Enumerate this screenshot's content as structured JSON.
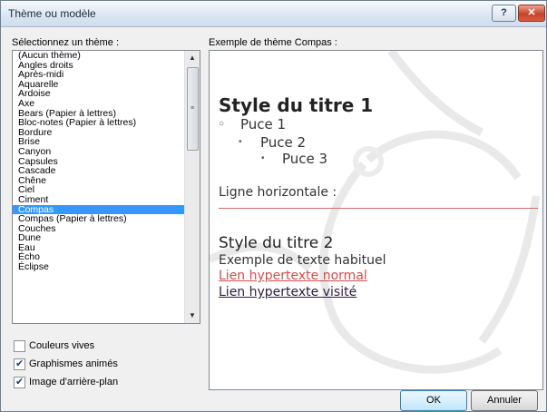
{
  "window": {
    "title": "Thème ou modèle",
    "help_label": "?",
    "close_label": "✕"
  },
  "theme_list": {
    "label": "Sélectionnez un thème :",
    "selected": "Compas",
    "items": [
      "(Aucun thème)",
      "Angles droits",
      "Après-midi",
      "Aquarelle",
      "Ardoise",
      "Axe",
      "Bears (Papier à lettres)",
      "Bloc-notes (Papier à lettres)",
      "Bordure",
      "Brise",
      "Canyon",
      "Capsules",
      "Cascade",
      "Chêne",
      "Ciel",
      "Ciment",
      "Compas",
      "Compas (Papier à lettres)",
      "Couches",
      "Dune",
      "Eau",
      "Écho",
      "Éclipse"
    ]
  },
  "preview": {
    "label": "Exemple de thème Compas :",
    "heading1": "Style du titre 1",
    "bullet1": "Puce 1",
    "bullet2": "Puce 2",
    "bullet3": "Puce 3",
    "hr_label": "Ligne horizontale :",
    "heading2": "Style du titre 2",
    "body_text": "Exemple de texte habituel",
    "link_normal": "Lien hypertexte normal",
    "link_visited": "Lien hypertexte visité"
  },
  "options": [
    {
      "label": "Couleurs vives",
      "checked": false
    },
    {
      "label": "Graphismes animés",
      "checked": true
    },
    {
      "label": "Image d'arrière-plan",
      "checked": true
    }
  ],
  "buttons": {
    "ok": "OK",
    "cancel": "Annuler"
  },
  "colors": {
    "selection": "#3399ff",
    "link_normal": "#d34b4b",
    "link_visited": "#2a1d38",
    "rule": "#d26767"
  }
}
